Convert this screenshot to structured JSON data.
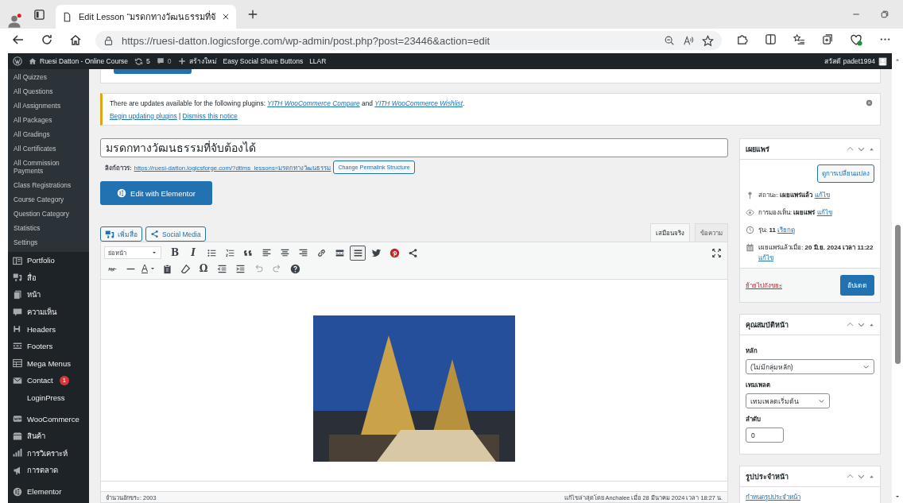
{
  "browser": {
    "tab_title": "Edit Lesson “มรดกทางวัฒนธรรมที่จั",
    "url": "https://ruesi-datton.logicsforge.com/wp-admin/post.php?post=23446&action=edit"
  },
  "admin_bar": {
    "site_name": "Ruesi Datton - Online Course",
    "updates": "5",
    "comments": "0",
    "new": "สร้างใหม่",
    "items": [
      "Easy Social Share Buttons",
      "LLAR"
    ],
    "greeting": "สวัสดี padet1994"
  },
  "sidebar": {
    "submenu": [
      "All Quizzes",
      "All Questions",
      "All Assignments",
      "All Packages",
      "All Gradings",
      "All Certificates",
      "All Commission Payments",
      "Class Registrations",
      "Course Category",
      "Question Category",
      "Statistics",
      "Settings"
    ],
    "menu_groups": [
      {
        "items": [
          {
            "label": "Portfolio"
          },
          {
            "label": "สื่อ"
          },
          {
            "label": "หน้า"
          },
          {
            "label": "ความเห็น"
          },
          {
            "label": "Headers"
          },
          {
            "label": "Footers"
          },
          {
            "label": "Mega Menus"
          },
          {
            "label": "Contact",
            "badge": "1"
          },
          {
            "label": "LoginPress"
          }
        ]
      },
      {
        "items": [
          {
            "label": "WooCommerce"
          },
          {
            "label": "สินค้า"
          },
          {
            "label": "การวิเคราะห์"
          },
          {
            "label": "การตลาด"
          }
        ]
      },
      {
        "items": [
          {
            "label": "Elementor"
          }
        ]
      }
    ]
  },
  "notice": {
    "message": "There are updates available for the following plugins:",
    "plugin_links": [
      "YITH WooCommerce Compare",
      "YITH WooCommerce Wishlist"
    ],
    "conjunction": "and",
    "end": ".",
    "actions": [
      "Begin updating plugins",
      "Dismiss this notice"
    ],
    "separator": "|"
  },
  "post": {
    "title": "มรดกทางวัฒนธรรมที่จับต้องได้",
    "permalink_label": "ลิงก์ถาวร:",
    "permalink_url": "https://ruesi-datton.logicsforge.com/?dtlms_lessons=มรดกทางวัฒนธรรม",
    "permalink_button": "Change Permalink Structure",
    "elementor_button": "Edit with Elementor",
    "media_buttons": [
      "เพิ่มสื่อ",
      "Social Media"
    ],
    "editor_tabs": [
      {
        "label": "เสมือนจริง",
        "selected": true
      },
      {
        "label": "ข้อความ",
        "selected": false
      }
    ],
    "toolbar": {
      "format": "ย่อหน้า",
      "glyphs": [
        "B",
        "I",
        "A",
        "Ω"
      ],
      "advanced_on": true
    },
    "status": {
      "character_count": "จำนวนอักขระ: 2003",
      "last_edited": "แก้ไขล่าสุดโดย Anchalee เมื่อ 28 มีนาคม 2024 เวลา 18:27 น."
    }
  },
  "publish": {
    "title": "เผยแพร่",
    "preview_button": "ดูการเปลี่ยนแปลง",
    "rows": [
      {
        "text": "สถานะ: **เผยแพร่แล้ว**",
        "link": "แก้ไข"
      },
      {
        "text": "การมองเห็น: **เผยแพร่**",
        "link": "แก้ไข"
      },
      {
        "text": "รุ่น: **11**",
        "link": "เรียกดู"
      },
      {
        "text": "เผยแพร่แล้วเมื่อ: **20 มิ.ย. 2024 เวลา 11:22**",
        "link": "แก้ไข"
      }
    ],
    "trash_link": "ย้ายไปถังขยะ",
    "update_button": "อัปเดต"
  },
  "page_attributes": {
    "title": "คุณสมบัติหน้า",
    "parent_label": "หลัก",
    "parent_value": "(ไม่มีกลุ่มหลัก)",
    "template_label": "เทมเพลต",
    "template_value": "เทมเพลตเริ่มต้น",
    "order_label": "ลำดับ",
    "order_value": "0"
  },
  "featured_image": {
    "title": "รูปประจำหน้า",
    "link": "กำหนดรูปประจำหน้า"
  }
}
